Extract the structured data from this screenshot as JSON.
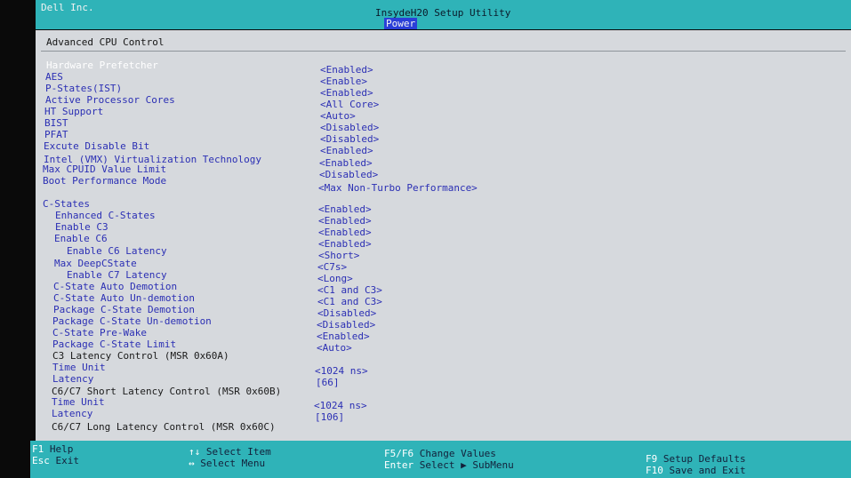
{
  "header": {
    "vendor": "Dell Inc.",
    "utility_title": "InsydeH20 Setup Utility",
    "active_tab": "Power"
  },
  "panel": {
    "title": "Advanced CPU Control"
  },
  "settings": [
    {
      "label": "Hardware Prefetcher",
      "value": "<Enabled>"
    },
    {
      "label": "AES",
      "value": "<Enable>"
    },
    {
      "label": "P-States(IST)",
      "value": "<Enabled>"
    },
    {
      "label": "Active Processor Cores",
      "value": "<All Core>"
    },
    {
      "label": "HT Support",
      "value": "<Auto>"
    },
    {
      "label": "BIST",
      "value": "<Disabled>"
    },
    {
      "label": "PFAT",
      "value": "<Disabled>"
    },
    {
      "label": "Excute Disable Bit",
      "value": "<Enabled>"
    },
    {
      "label": "Intel (VMX) Virtualization Technology",
      "value": "<Enabled>"
    },
    {
      "label": "Max CPUID Value Limit",
      "value": "<Disabled>"
    },
    {
      "label": "Boot Performance Mode",
      "value": "<Max Non-Turbo Performance>"
    },
    {
      "label": "C-States",
      "value": "<Enabled>"
    },
    {
      "label": "Enhanced C-States",
      "value": "<Enabled>"
    },
    {
      "label": "Enable C3",
      "value": "<Enabled>"
    },
    {
      "label": "Enable C6",
      "value": "<Enabled>"
    },
    {
      "label": "Enable C6 Latency",
      "value": "<Short>"
    },
    {
      "label": "Max DeepCState",
      "value": "<C7s>"
    },
    {
      "label": "Enable C7 Latency",
      "value": "<Long>"
    },
    {
      "label": "C-State Auto Demotion",
      "value": "<C1 and C3>"
    },
    {
      "label": "C-State Auto Un-demotion",
      "value": "<C1 and C3>"
    },
    {
      "label": "Package C-State Demotion",
      "value": "<Disabled>"
    },
    {
      "label": "Package C-State Un-demotion",
      "value": "<Disabled>"
    },
    {
      "label": "C-State Pre-Wake",
      "value": "<Enabled>"
    },
    {
      "label": "Package C-State Limit",
      "value": "<Auto>"
    },
    {
      "label": "C3 Latency Control (MSR 0x60A)",
      "value": ""
    },
    {
      "label": "Time Unit",
      "value": "<1024 ns>"
    },
    {
      "label": "Latency",
      "value": "[66]"
    },
    {
      "label": "C6/C7 Short Latency Control (MSR 0x60B)",
      "value": ""
    },
    {
      "label": "Time Unit",
      "value": "<1024 ns>"
    },
    {
      "label": "Latency",
      "value": "[106]"
    },
    {
      "label": "C6/C7 Long Latency Control (MSR 0x60C)",
      "value": ""
    }
  ],
  "footer": {
    "f1_key": "F1",
    "f1_desc": "Help",
    "esc_key": "Esc",
    "esc_desc": "Exit",
    "updown_key": "↑↓",
    "updown_desc": "Select Item",
    "leftright_key": "↔",
    "leftright_desc": "Select Menu",
    "f5f6_key": "F5/F6",
    "f5f6_desc": "Change Values",
    "enter_key": "Enter",
    "enter_desc": "Select ▶ SubMenu",
    "f9_key": "F9",
    "f9_desc": "Setup Defaults",
    "f10_key": "F10",
    "f10_desc": "Save and Exit"
  },
  "colors": {
    "frame_teal": "#2fb3b8",
    "panel_bg": "#d6d9dd",
    "option_blue": "#2b2fb4",
    "tab_highlight": "#2a3fd8"
  }
}
